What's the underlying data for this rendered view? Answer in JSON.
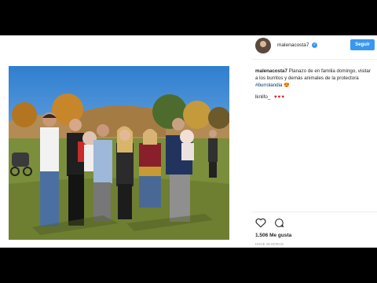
{
  "post": {
    "username": "malenacosta7",
    "follow_label": "Seguir",
    "caption_user": "malenacosta7",
    "caption_text": "Planazo de en familia domingo, visitar a los burritos y demás animales de la protectora",
    "hashtag": "#burrolandia",
    "caption_emoji": "😍",
    "comment_user": "lknlifo_",
    "comment_hearts": "♥♥♥",
    "likes": "1.506 Me gusta",
    "date": "HACE 19 HORAS"
  },
  "icons": [
    "verified-badge-icon",
    "heart-icon",
    "comment-icon"
  ],
  "colors": {
    "accent": "#3897f0",
    "heart": "#d0202e",
    "background": "#000000"
  }
}
